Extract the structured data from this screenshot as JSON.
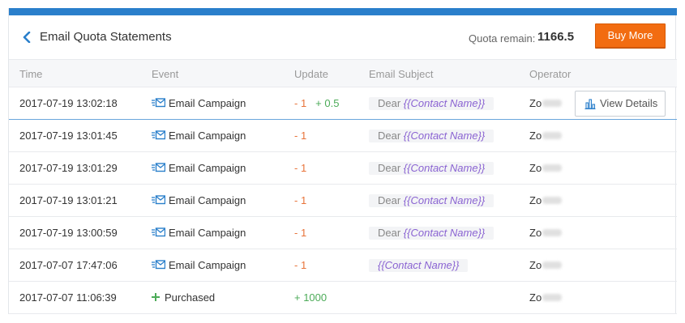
{
  "header": {
    "title": "Email Quota Statements",
    "quota_label": "Quota remain:",
    "quota_value": "1166.5",
    "buy_button": "Buy More"
  },
  "columns": {
    "time": "Time",
    "event": "Event",
    "update": "Update",
    "subject": "Email Subject",
    "operator": "Operator"
  },
  "rows": [
    {
      "time": "2017-07-19 13:02:18",
      "event": "Email Campaign",
      "update_neg": "- 1",
      "update_pos": "+ 0.5",
      "subject_prefix": "Dear ",
      "subject_var": "{{Contact Name}}",
      "operator": "Zo"
    },
    {
      "time": "2017-07-19 13:01:45",
      "event": "Email Campaign",
      "update_neg": "- 1",
      "update_pos": "",
      "subject_prefix": "Dear ",
      "subject_var": "{{Contact Name}}",
      "operator": "Zo"
    },
    {
      "time": "2017-07-19 13:01:29",
      "event": "Email Campaign",
      "update_neg": "- 1",
      "update_pos": "",
      "subject_prefix": "Dear ",
      "subject_var": "{{Contact Name}}",
      "operator": "Zo"
    },
    {
      "time": "2017-07-19 13:01:21",
      "event": "Email Campaign",
      "update_neg": "- 1",
      "update_pos": "",
      "subject_prefix": "Dear ",
      "subject_var": "{{Contact Name}}",
      "operator": "Zo"
    },
    {
      "time": "2017-07-19 13:00:59",
      "event": "Email Campaign",
      "update_neg": "- 1",
      "update_pos": "",
      "subject_prefix": "Dear ",
      "subject_var": "{{Contact Name}}",
      "operator": "Zo"
    },
    {
      "time": "2017-07-07 17:47:06",
      "event": "Email Campaign",
      "update_neg": "- 1",
      "update_pos": "",
      "subject_prefix": "",
      "subject_var": "{{Contact Name}}",
      "operator": "Zo"
    },
    {
      "time": "2017-07-07 11:06:39",
      "event": "Purchased",
      "update_neg": "",
      "update_pos": "+ 1000",
      "subject_prefix": "",
      "subject_var": "",
      "operator": "Zo"
    }
  ],
  "row_action": {
    "view_details": "View Details"
  },
  "colors": {
    "accent": "#2a7fcb",
    "buy": "#f26c11",
    "negative": "#e8743b",
    "positive": "#4cab58",
    "variable": "#8a63d2"
  }
}
